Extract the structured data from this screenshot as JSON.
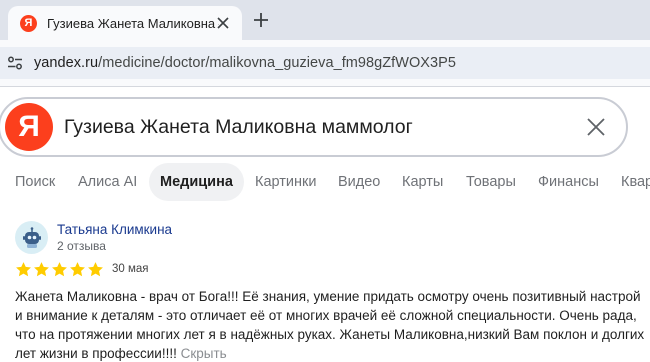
{
  "browser": {
    "tab_title": "Гузиева Жанета Маликовна —",
    "tab_favicon_letter": "Я",
    "url_host": "yandex.ru",
    "url_path": "/medicine/doctor/malikovna_guzieva_fm98gZfWOX3P5"
  },
  "search": {
    "logo_letter": "Я",
    "query": "Гузиева Жанета Маликовна маммолог"
  },
  "services": [
    {
      "label": "Поиск",
      "active": false
    },
    {
      "label": "Алиса AI",
      "active": false
    },
    {
      "label": "Медицина",
      "active": true
    },
    {
      "label": "Картинки",
      "active": false
    },
    {
      "label": "Видео",
      "active": false
    },
    {
      "label": "Карты",
      "active": false
    },
    {
      "label": "Товары",
      "active": false
    },
    {
      "label": "Финансы",
      "active": false
    },
    {
      "label": "Квар",
      "active": false
    }
  ],
  "review": {
    "author": "Татьяна Климкина",
    "reviews_count": "2 отзыва",
    "rating": 5,
    "date": "30 мая",
    "text": "Жанета Маликовна - врач от Бога!!! Её знания, умение придать осмотру очень позитивный настрой и внимание к деталям - это отличает её от многих врачей её сложной специальности. Очень рада, что на протяжении многих лет я в надёжных руках. Жанеты Маликовна,низкий Вам поклон и долгих лет жизни в профессии!!!! ",
    "hide_label": "Скрыть"
  },
  "colors": {
    "brand_red": "#fc3f1d",
    "star_yellow": "#ffcc00",
    "author_link": "#1a3a8f"
  }
}
